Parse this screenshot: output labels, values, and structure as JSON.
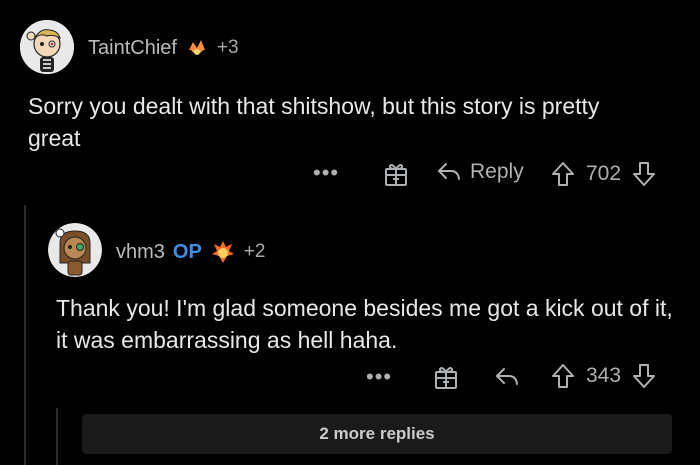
{
  "comment1": {
    "username": "TaintChief",
    "award_extra": "+3",
    "text": "Sorry you dealt with that shitshow, but this story is pretty great",
    "more_label": "•••",
    "reply_label": "Reply",
    "score": "702"
  },
  "comment2": {
    "username": "vhm3",
    "op_badge": "OP",
    "award_extra": "+2",
    "text": "Thank you! I'm glad someone besides me got a kick out of it, it was embarrassing as hell haha.",
    "more_label": "•••",
    "score": "343"
  },
  "more_replies_label": "2 more replies",
  "colors": {
    "background": "#000000",
    "op_blue": "#3f8ce6",
    "text": "#e6e8ea",
    "muted": "#aeb1b3"
  },
  "icons": [
    "award-gift-icon",
    "reply-arrow-icon",
    "upvote-icon",
    "downvote-icon",
    "flame-award-icon",
    "crystal-award-icon"
  ]
}
